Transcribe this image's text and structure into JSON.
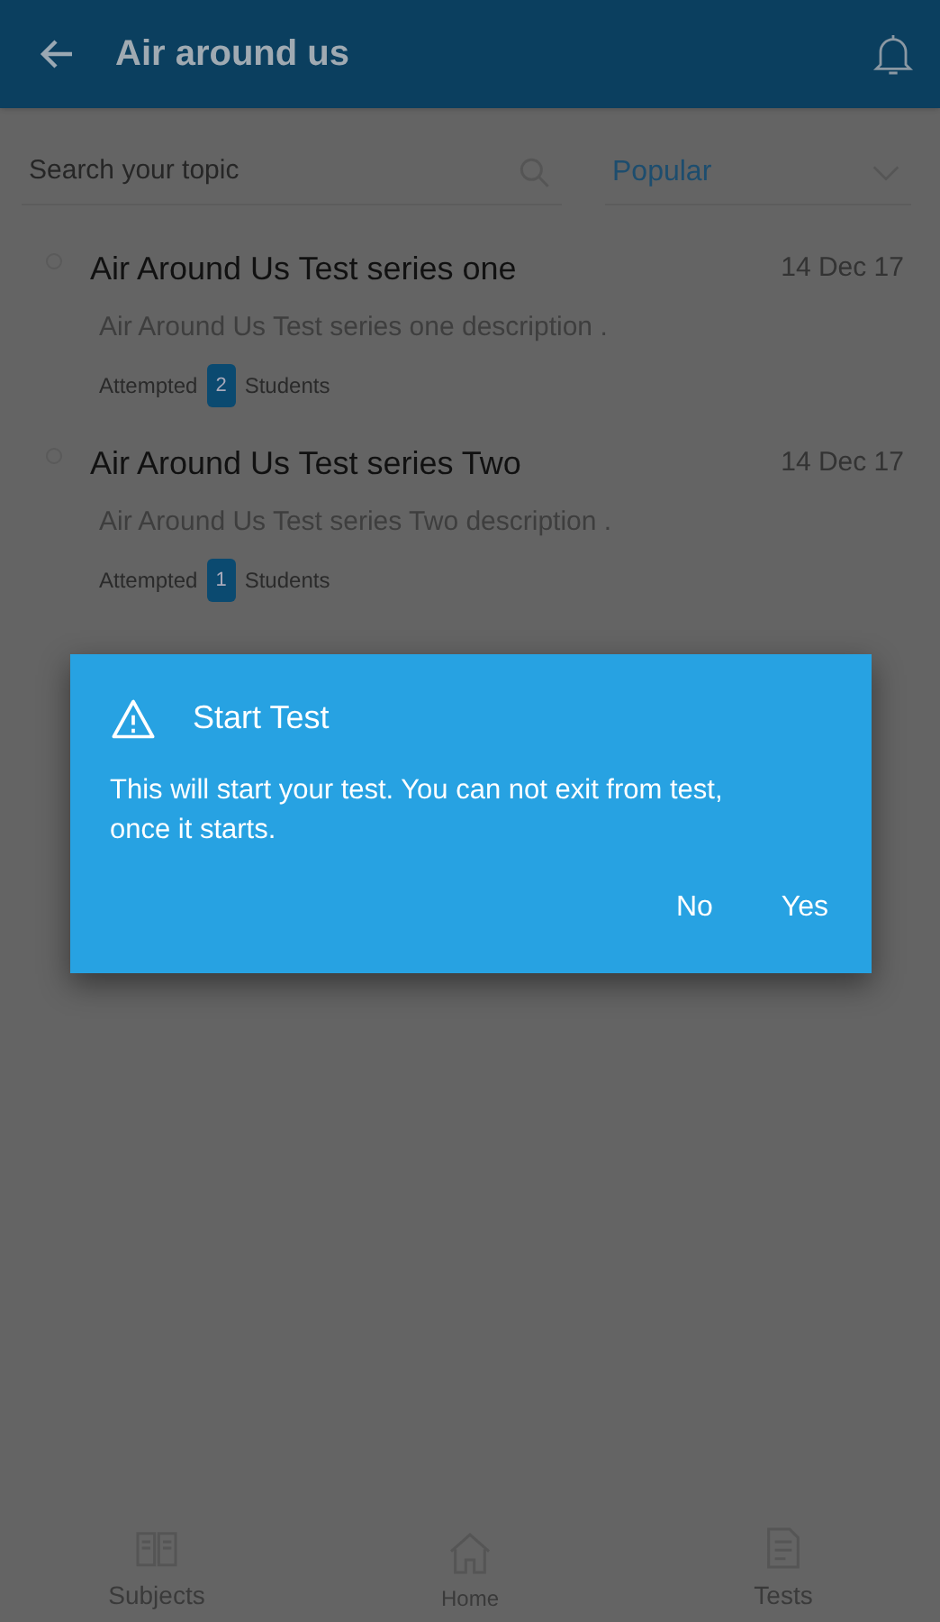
{
  "app_bar": {
    "title": "Air around us"
  },
  "search": {
    "placeholder": "Search your topic"
  },
  "sort": {
    "value": "Popular"
  },
  "tests": [
    {
      "title": "Air Around Us Test series one",
      "date": "14 Dec 17",
      "description": "Air Around Us Test series one description .",
      "attempted_label": "Attempted",
      "count": "2",
      "students_label": "Students"
    },
    {
      "title": "Air Around Us Test series Two",
      "date": "14 Dec 17",
      "description": "Air Around Us Test series Two description .",
      "attempted_label": "Attempted",
      "count": "1",
      "students_label": "Students"
    }
  ],
  "dialog": {
    "title": "Start Test",
    "message": "This will start your test. You can not exit from test, once it starts.",
    "buttons": [
      "No",
      "Yes"
    ]
  },
  "bottom_nav": [
    {
      "label": "Subjects",
      "kind": "book"
    },
    {
      "label": "Home",
      "kind": "home"
    },
    {
      "label": "Tests",
      "kind": "doc"
    }
  ]
}
